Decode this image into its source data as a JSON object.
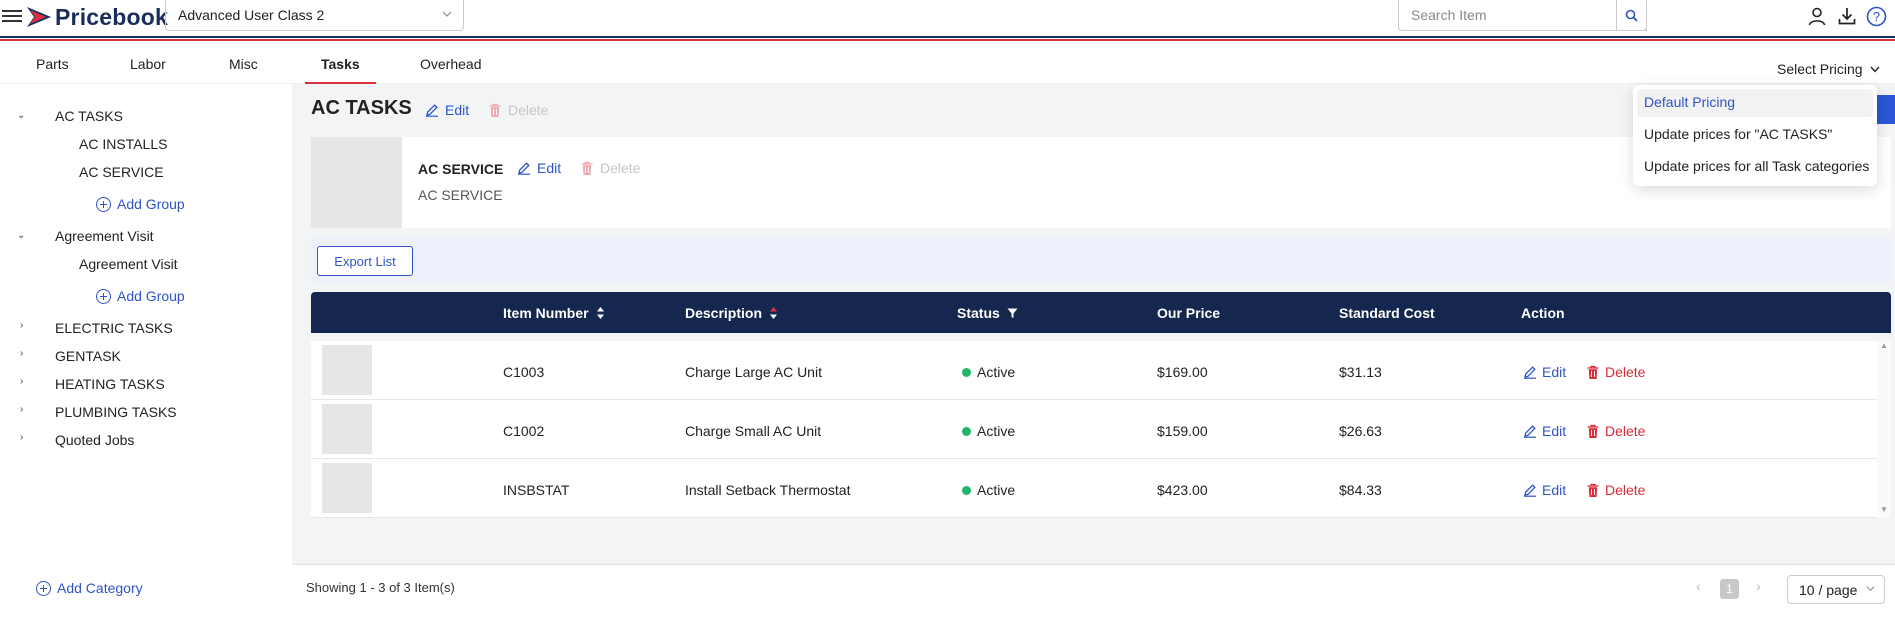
{
  "header": {
    "app_name": "Pricebook",
    "class_select_value": "Advanced User Class 2",
    "search_placeholder": "Search Item"
  },
  "tabs": [
    {
      "label": "Parts",
      "active": false
    },
    {
      "label": "Labor",
      "active": false
    },
    {
      "label": "Misc",
      "active": false
    },
    {
      "label": "Tasks",
      "active": true
    },
    {
      "label": "Overhead",
      "active": false
    }
  ],
  "pricing": {
    "label": "Select Pricing",
    "options": [
      {
        "label": "Default Pricing",
        "selected": true
      },
      {
        "label": "Update prices for \"AC TASKS\"",
        "selected": false
      },
      {
        "label": "Update prices for all Task categories",
        "selected": false
      }
    ]
  },
  "sidebar": {
    "categories": [
      {
        "label": "AC TASKS",
        "expanded": true,
        "groups": [
          "AC INSTALLS",
          "AC SERVICE"
        ],
        "add_group_label": "Add Group"
      },
      {
        "label": "Agreement Visit",
        "expanded": true,
        "groups": [
          "Agreement Visit"
        ],
        "add_group_label": "Add Group"
      },
      {
        "label": "ELECTRIC TASKS",
        "expanded": false
      },
      {
        "label": "GENTASK",
        "expanded": false
      },
      {
        "label": "HEATING TASKS",
        "expanded": false
      },
      {
        "label": "PLUMBING TASKS",
        "expanded": false
      },
      {
        "label": "Quoted Jobs",
        "expanded": false
      }
    ],
    "add_category_label": "Add Category"
  },
  "section": {
    "title": "AC TASKS",
    "edit_label": "Edit",
    "delete_label": "Delete"
  },
  "group_card": {
    "title": "AC SERVICE",
    "subtitle": "AC SERVICE",
    "edit_label": "Edit",
    "delete_label": "Delete"
  },
  "export_label": "Export List",
  "table": {
    "columns": [
      "Item Number",
      "Description",
      "Status",
      "Our Price",
      "Standard Cost",
      "Action"
    ],
    "rows": [
      {
        "item_number": "C1003",
        "description": "Charge Large AC Unit",
        "status": "Active",
        "our_price": "$169.00",
        "standard_cost": "$31.13"
      },
      {
        "item_number": "C1002",
        "description": "Charge Small AC Unit",
        "status": "Active",
        "our_price": "$159.00",
        "standard_cost": "$26.63"
      },
      {
        "item_number": "INSBSTAT",
        "description": "Install Setback Thermostat",
        "status": "Active",
        "our_price": "$423.00",
        "standard_cost": "$84.33"
      }
    ],
    "row_edit_label": "Edit",
    "row_delete_label": "Delete"
  },
  "footer": {
    "showing": "Showing 1 - 3 of 3 Item(s)",
    "current_page": "1",
    "page_size": "10 / page"
  },
  "colors": {
    "brand_navy": "#1a2e5c",
    "brand_red": "#d9323c",
    "link_blue": "#2f54c8",
    "table_header": "#15274f",
    "status_active": "#1fb66a",
    "delete_red": "#d92b3a"
  }
}
